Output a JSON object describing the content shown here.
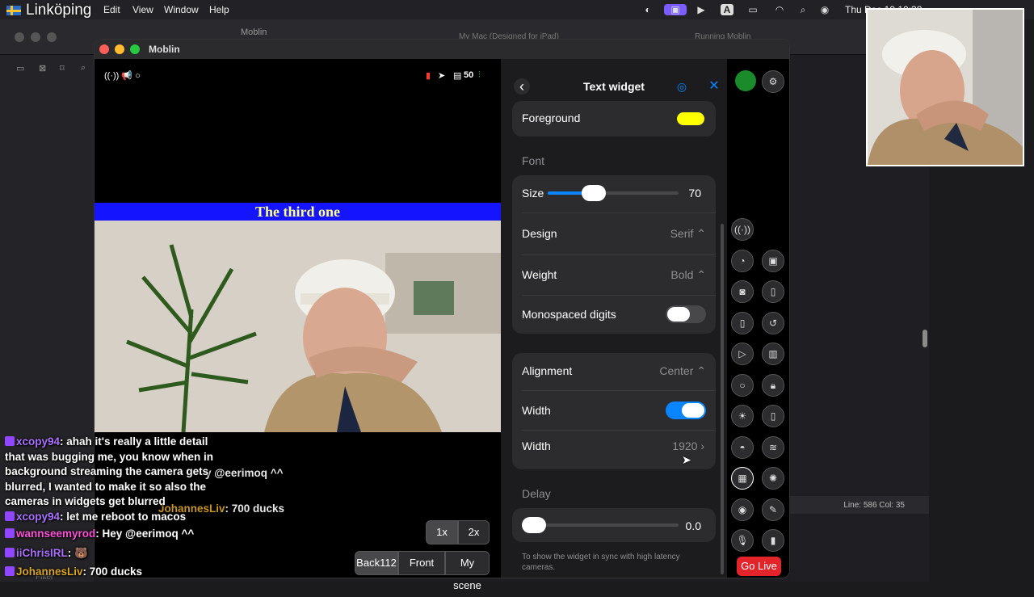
{
  "menubar": {
    "location": "Linköping",
    "items": [
      "Edit",
      "View",
      "Window",
      "Help"
    ],
    "clock": "Thu Dec 19 10:38"
  },
  "ide": {
    "app_title": "Moblin",
    "breadcrumb_device": "My Mac (Designed for iPad)",
    "status_text": "Running Moblin",
    "cursor": "Line: 586  Col: 35",
    "filter_placeholder": "Filter"
  },
  "window": {
    "title": "Moblin"
  },
  "preview": {
    "status_fps": "50",
    "banner_text": "The third one"
  },
  "panel": {
    "title": "Text widget",
    "foreground_label": "Foreground",
    "foreground_color": "#ffff00",
    "font_section": "Font",
    "size_label": "Size",
    "size_value": "70",
    "size_fraction": 0.35,
    "design_label": "Design",
    "design_value": "Serif",
    "weight_label": "Weight",
    "weight_value": "Bold",
    "mono_label": "Monospaced digits",
    "alignment_label": "Alignment",
    "alignment_value": "Center",
    "width_toggle_label": "Width",
    "width_label": "Width",
    "width_value": "1920",
    "delay_section": "Delay",
    "delay_value": "0.0",
    "delay_hint": "To show the widget in sync with high latency cameras."
  },
  "controls": {
    "zoom": [
      "1x",
      "2x"
    ],
    "scenes": [
      "Back112",
      "Front",
      "My scene"
    ],
    "go_live": "Go Live"
  },
  "chat": [
    {
      "user": "xcopy94",
      "color": "#a970ff",
      "text": ": ahah it's really a little detail"
    },
    {
      "user": "",
      "color": "#ffffff",
      "text": "that was bugging me, you know when in"
    },
    {
      "user": "",
      "color": "#ffffff",
      "text": "background streaming the camera gets"
    },
    {
      "user": "",
      "color": "#ffffff",
      "text": "blurred, I wanted to make it so also the"
    },
    {
      "user": "",
      "color": "#ffffff",
      "text": "cameras in widgets get blurred"
    },
    {
      "user": "xcopy94",
      "color": "#a970ff",
      "text": ": let me reboot to macos"
    },
    {
      "user": "wannseemyrod",
      "color": "#ff4fd8",
      "text": ": Hey @eerimoq ^^"
    },
    {
      "user": "iiChrisIRL",
      "color": "#a970ff",
      "text": ": 🐻"
    },
    {
      "user": "JohannesLiv",
      "color": "#daa520",
      "text": ": 700 ducks"
    }
  ],
  "chat_ghost": [
    {
      "text": "y @eerimoq ^^"
    },
    {
      "user": "JohannesLiv",
      "text": ": 700 ducks"
    }
  ]
}
